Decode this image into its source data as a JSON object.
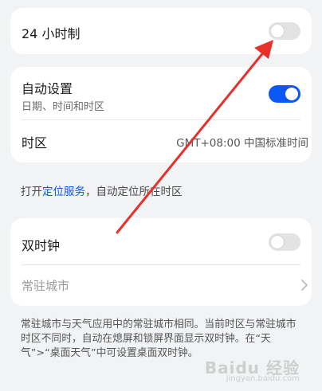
{
  "clock": {
    "label_24h": "24 小时制",
    "toggle_24h_on": false
  },
  "auto": {
    "title": "自动设置",
    "subtitle": "日期、时间和时区",
    "toggle_on": true,
    "timezone_label": "时区",
    "timezone_value": "GMT+08:00 中国标准时间"
  },
  "hint": {
    "prefix": "打开",
    "link": "定位服务",
    "suffix": "，自动定位所在时区"
  },
  "dual": {
    "title": "双时钟",
    "toggle_on": false,
    "city_label": "常驻城市"
  },
  "description": "常驻城市与天气应用中的常驻城市相同。当前时区与常驻城市时区不同时，自动在熄屏和锁屏界面显示双时钟。在“天气”>“桌面天气”中可设置桌面双时钟。",
  "watermark": {
    "brand": "Baidu 经验",
    "sub": "jingyan.baidu.com"
  },
  "colors": {
    "accent": "#0a59f7",
    "arrow": "#e8302a"
  }
}
